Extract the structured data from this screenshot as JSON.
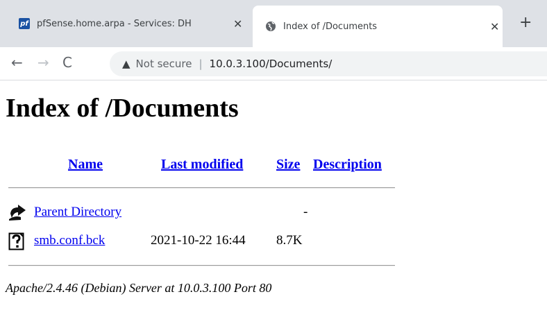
{
  "browser": {
    "tabs": [
      {
        "title": "pfSense.home.arpa - Services: DH",
        "icon": "pfsense-icon",
        "active": false
      },
      {
        "title": "Index of /Documents",
        "icon": "globe-icon",
        "active": true
      }
    ],
    "close_glyph": "✕",
    "new_tab_glyph": "+",
    "back_glyph": "←",
    "forward_glyph": "→",
    "reload_glyph": "C",
    "warning_glyph": "▲",
    "security_label": "Not secure",
    "separator": "|",
    "url": "10.0.3.100/Documents/",
    "favicon_text": "pf"
  },
  "page": {
    "title": "Index of /Documents",
    "columns": [
      "Name",
      "Last modified",
      "Size",
      "Description"
    ],
    "rows": [
      {
        "name": "Parent Directory",
        "modified": "",
        "size": "-",
        "description": "",
        "icon": "back-arrow-icon"
      },
      {
        "name": "smb.conf.bck",
        "modified": "2021-10-22 16:44",
        "size": "8.7K",
        "description": "",
        "icon": "unknown-file-icon"
      }
    ],
    "footer": "Apache/2.4.46 (Debian) Server at 10.0.3.100 Port 80"
  }
}
